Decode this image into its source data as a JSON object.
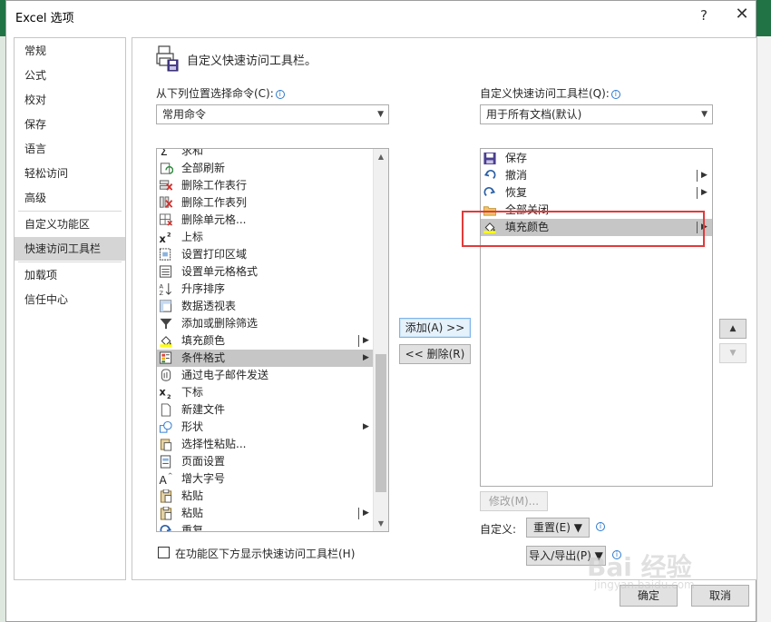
{
  "window": {
    "title": "Excel 选项",
    "help": "?",
    "close": "✕"
  },
  "nav": {
    "items": [
      {
        "label": "常规"
      },
      {
        "label": "公式"
      },
      {
        "label": "校对"
      },
      {
        "label": "保存"
      },
      {
        "label": "语言"
      },
      {
        "label": "轻松访问"
      },
      {
        "label": "高级"
      },
      {
        "label": "自定义功能区"
      },
      {
        "label": "快速访问工具栏",
        "selected": true
      },
      {
        "label": "加载项"
      },
      {
        "label": "信任中心"
      }
    ]
  },
  "header": {
    "title": "自定义快速访问工具栏。",
    "icon": "quick-access-toolbar-icon"
  },
  "left": {
    "choose_label": "从下列位置选择命令(C):",
    "choose_value": "常用命令",
    "commands": [
      {
        "label": "求和",
        "icon": "sum-icon"
      },
      {
        "label": "全部刷新",
        "icon": "refresh-all-icon"
      },
      {
        "label": "删除工作表行",
        "icon": "delete-row-icon"
      },
      {
        "label": "删除工作表列",
        "icon": "delete-column-icon"
      },
      {
        "label": "删除单元格...",
        "icon": "delete-cells-icon"
      },
      {
        "label": "上标",
        "icon": "superscript-icon"
      },
      {
        "label": "设置打印区域",
        "icon": "print-area-icon"
      },
      {
        "label": "设置单元格格式",
        "icon": "format-cells-icon"
      },
      {
        "label": "升序排序",
        "icon": "sort-ascending-icon"
      },
      {
        "label": "数据透视表",
        "icon": "pivot-table-icon"
      },
      {
        "label": "添加或删除筛选",
        "icon": "filter-icon"
      },
      {
        "label": "填充颜色",
        "icon": "fill-color-icon",
        "split": true
      },
      {
        "label": "条件格式",
        "icon": "conditional-format-icon",
        "submenu": true,
        "selected": true
      },
      {
        "label": "通过电子邮件发送",
        "icon": "email-icon"
      },
      {
        "label": "下标",
        "icon": "subscript-icon"
      },
      {
        "label": "新建文件",
        "icon": "new-file-icon"
      },
      {
        "label": "形状",
        "icon": "shapes-icon",
        "submenu": true
      },
      {
        "label": "选择性粘贴...",
        "icon": "paste-special-icon"
      },
      {
        "label": "页面设置",
        "icon": "page-setup-icon"
      },
      {
        "label": "增大字号",
        "icon": "increase-font-icon"
      },
      {
        "label": "粘贴",
        "icon": "paste-icon"
      },
      {
        "label": "粘贴",
        "icon": "paste-icon",
        "split": true
      },
      {
        "label": "重复",
        "icon": "redo-icon"
      }
    ],
    "checkbox_label": "在功能区下方显示快速访问工具栏(H)"
  },
  "middle": {
    "add_label": "添加(A) >>",
    "remove_label": "<< 删除(R)"
  },
  "right": {
    "customize_label": "自定义快速访问工具栏(Q):",
    "customize_value": "用于所有文档(默认)",
    "items": [
      {
        "label": "保存",
        "icon": "save-icon"
      },
      {
        "label": "撤消",
        "icon": "undo-icon",
        "split": true
      },
      {
        "label": "恢复",
        "icon": "redo-icon",
        "split": true
      },
      {
        "label": "全部关闭",
        "icon": "close-all-icon"
      },
      {
        "label": "填充颜色",
        "icon": "fill-color-icon",
        "split": true,
        "selected": true
      }
    ],
    "modify_label": "修改(M)...",
    "customizations_label": "自定义:",
    "reset_label": "重置(E) ▼",
    "import_export_label": "导入/导出(P) ▼",
    "move_up": "▲",
    "move_down": "▼"
  },
  "footer": {
    "ok_label": "确定",
    "cancel_label": "取消"
  },
  "watermark": {
    "text": "Bai 经验",
    "sub": "jingyan.baidu.com"
  },
  "colors": {
    "highlight": "#e23a3a",
    "selection": "#c6c6c6",
    "fill_yellow": "#ffff00"
  }
}
